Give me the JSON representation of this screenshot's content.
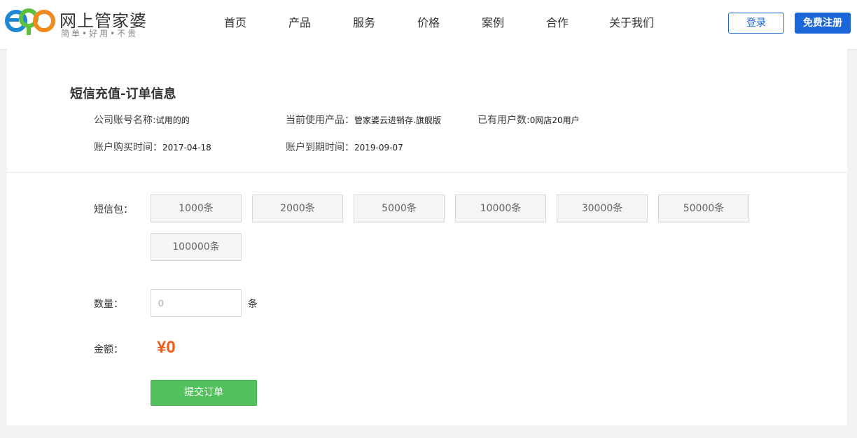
{
  "header": {
    "logo_name": "网上管家婆",
    "logo_slogan": "简单•好用•不贵",
    "nav": [
      "首页",
      "产品",
      "服务",
      "价格",
      "案例",
      "合作",
      "关于我们"
    ],
    "login_label": "登录",
    "register_label": "免费注册"
  },
  "page": {
    "title": "短信充值-订单信息",
    "company_label": "公司账号名称:",
    "company_value": "试用的的",
    "product_label": "当前使用产品：",
    "product_value": "管家婆云进销存.旗舰版",
    "users_label": "已有用户数:",
    "users_value": "0网店20用户",
    "purchase_label": "账户购买时间：",
    "purchase_value": "2017-04-18",
    "expire_label": "账户到期时间：",
    "expire_value": "2019-09-07"
  },
  "form": {
    "package_label": "短信包：",
    "packages": [
      "1000条",
      "2000条",
      "5000条",
      "10000条",
      "30000条",
      "50000条",
      "100000条"
    ],
    "quantity_label": "数量：",
    "quantity_placeholder": "0",
    "quantity_unit": "条",
    "amount_label": "金额：",
    "amount_value": "¥0",
    "submit_label": "提交订单"
  },
  "colors": {
    "brand_blue": "#1a66d8",
    "amount_orange": "#f25c1a",
    "submit_green": "#53c25e"
  }
}
